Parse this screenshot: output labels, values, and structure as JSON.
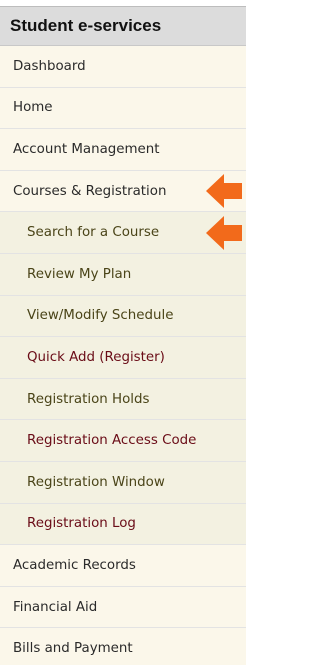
{
  "header": {
    "title": "Student e-services"
  },
  "nav": {
    "items": [
      {
        "label": "Dashboard"
      },
      {
        "label": "Home"
      },
      {
        "label": "Account Management"
      },
      {
        "label": "Courses & Registration"
      },
      {
        "label": "Search for a Course"
      },
      {
        "label": "Review My Plan"
      },
      {
        "label": "View/Modify Schedule"
      },
      {
        "label": "Quick Add (Register)"
      },
      {
        "label": "Registration Holds"
      },
      {
        "label": "Registration Access Code"
      },
      {
        "label": "Registration Window"
      },
      {
        "label": "Registration Log"
      },
      {
        "label": "Academic Records"
      },
      {
        "label": "Financial Aid"
      },
      {
        "label": "Bills and Payment"
      }
    ]
  },
  "colors": {
    "header_bg": "#dcdcdc",
    "top_item_bg": "#fbf7ea",
    "sub_item_bg": "#f3f1e1",
    "sub_text_olive": "#4a4418",
    "sub_text_maroon": "#6a0c17",
    "arrow": "#f26a1b"
  },
  "icons": {
    "pointer_arrow": "arrow-left-icon"
  }
}
